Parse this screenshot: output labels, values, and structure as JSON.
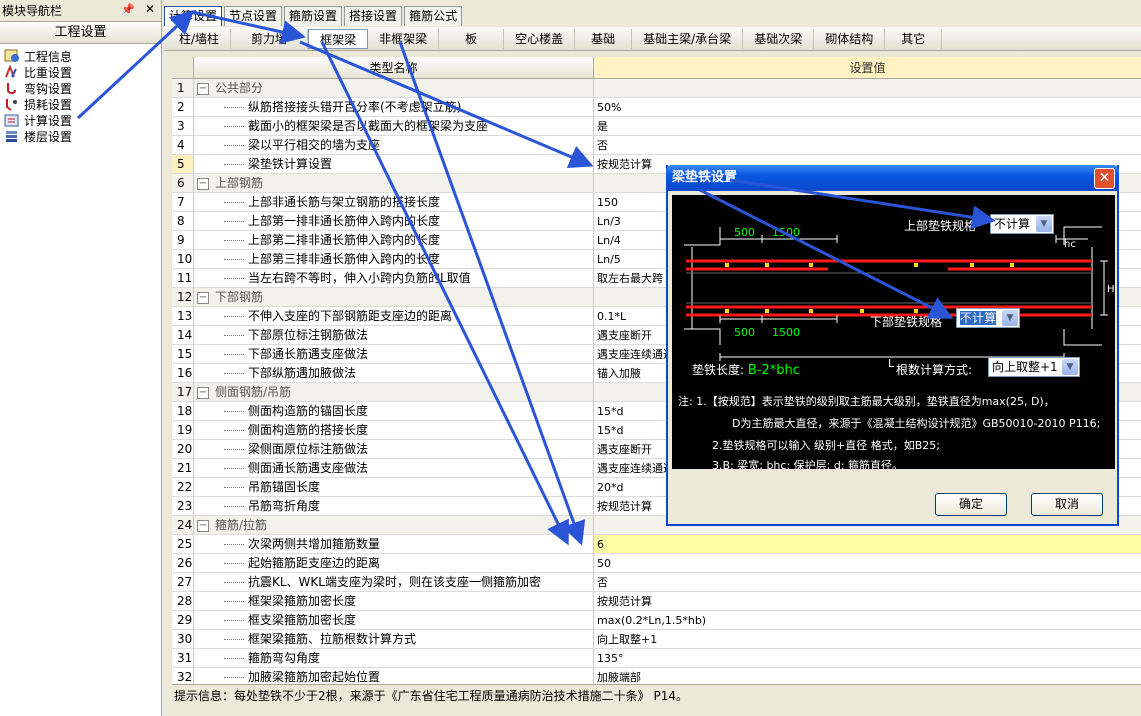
{
  "nav": {
    "title": "模块导航栏",
    "pin": "📌",
    "close": "✕",
    "section": "工程设置",
    "items": [
      {
        "label": "工程信息",
        "icon": "info-icon"
      },
      {
        "label": "比重设置",
        "icon": "weight-icon"
      },
      {
        "label": "弯钩设置",
        "icon": "hook-icon"
      },
      {
        "label": "损耗设置",
        "icon": "loss-icon"
      },
      {
        "label": "计算设置",
        "icon": "calc-icon"
      },
      {
        "label": "楼层设置",
        "icon": "floor-icon"
      }
    ]
  },
  "tabs": [
    "计算设置",
    "节点设置",
    "箍筋设置",
    "搭接设置",
    "箍筋公式"
  ],
  "subtabs": [
    "柱/墙柱",
    "剪力墙",
    "框架梁",
    "非框架梁",
    "板",
    "空心楼盖",
    "基础",
    "基础主梁/承台梁",
    "基础次梁",
    "砌体结构",
    "其它"
  ],
  "grid": {
    "col_name": "类型名称",
    "col_value": "设置值",
    "rows": [
      {
        "n": "1",
        "name": "公共部分",
        "value": "",
        "group": true
      },
      {
        "n": "2",
        "name": "纵筋搭接接头错开百分率(不考虑架立筋)",
        "value": "50%"
      },
      {
        "n": "3",
        "name": "截面小的框架梁是否以截面大的框架梁为支座",
        "value": "是"
      },
      {
        "n": "4",
        "name": "梁以平行相交的墙为支座",
        "value": "否"
      },
      {
        "n": "5",
        "name": "梁垫铁计算设置",
        "value": "按规范计算",
        "hilite": true
      },
      {
        "n": "6",
        "name": "上部钢筋",
        "value": "",
        "group": true
      },
      {
        "n": "7",
        "name": "上部非通长筋与架立钢筋的搭接长度",
        "value": "150"
      },
      {
        "n": "8",
        "name": "上部第一排非通长筋伸入跨内的长度",
        "value": "Ln/3"
      },
      {
        "n": "9",
        "name": "上部第二排非通长筋伸入跨内的长度",
        "value": "Ln/4"
      },
      {
        "n": "10",
        "name": "上部第三排非通长筋伸入跨内的长度",
        "value": "Ln/5"
      },
      {
        "n": "11",
        "name": "当左右跨不等时，伸入小跨内负筋的L取值",
        "value": "取左右最大跨"
      },
      {
        "n": "12",
        "name": "下部钢筋",
        "value": "",
        "group": true
      },
      {
        "n": "13",
        "name": "不伸入支座的下部钢筋距支座边的距离",
        "value": "0.1*L"
      },
      {
        "n": "14",
        "name": "下部原位标注钢筋做法",
        "value": "遇支座断开"
      },
      {
        "n": "15",
        "name": "下部通长筋遇支座做法",
        "value": "遇支座连续通过"
      },
      {
        "n": "16",
        "name": "下部纵筋遇加腋做法",
        "value": "锚入加腋"
      },
      {
        "n": "17",
        "name": "侧面钢筋/吊筋",
        "value": "",
        "group": true
      },
      {
        "n": "18",
        "name": "侧面构造筋的锚固长度",
        "value": "15*d"
      },
      {
        "n": "19",
        "name": "侧面构造筋的搭接长度",
        "value": "15*d"
      },
      {
        "n": "20",
        "name": "梁侧面原位标注筋做法",
        "value": "遇支座断开"
      },
      {
        "n": "21",
        "name": "侧面通长筋遇支座做法",
        "value": "遇支座连续通过"
      },
      {
        "n": "22",
        "name": "吊筋锚固长度",
        "value": "20*d"
      },
      {
        "n": "23",
        "name": "吊筋弯折角度",
        "value": "按规范计算"
      },
      {
        "n": "24",
        "name": "箍筋/拉筋",
        "value": "",
        "group": true
      },
      {
        "n": "25",
        "name": "次梁两侧共增加箍筋数量",
        "value": "6",
        "yellow": true
      },
      {
        "n": "26",
        "name": "起始箍筋距支座边的距离",
        "value": "50"
      },
      {
        "n": "27",
        "name": "抗震KL、WKL端支座为梁时，则在该支座一侧箍筋加密",
        "value": "否"
      },
      {
        "n": "28",
        "name": "框架梁箍筋加密长度",
        "value": "按规范计算"
      },
      {
        "n": "29",
        "name": "框支梁箍筋加密长度",
        "value": "max(0.2*Ln,1.5*hb)"
      },
      {
        "n": "30",
        "name": "框架梁箍筋、拉筋根数计算方式",
        "value": "向上取整+1"
      },
      {
        "n": "31",
        "name": "箍筋弯勾角度",
        "value": "135°"
      },
      {
        "n": "32",
        "name": "加腋梁箍筋加密起始位置",
        "value": "加腋端部"
      }
    ]
  },
  "status": "提示信息：每处垫铁不少于2根，来源于《广东省住宅工程质量通病防治技术措施二十条》 P14。",
  "dialog": {
    "title": "梁垫铁设置",
    "close": "✕",
    "top_label": "上部垫铁规格",
    "top_value": "不计算",
    "bottom_label": "下部垫铁规格",
    "bottom_value": "不计算",
    "length_label": "垫铁长度:",
    "length_formula": "B-2*bhc",
    "count_label": "根数计算方式:",
    "count_value": "向上取整+1",
    "dims": {
      "d500": "500",
      "d1500": "1500",
      "hc": "hc",
      "L": "L",
      "H": "H"
    },
    "notes": [
      "注: 1.【按规范】表示垫铁的级别取主筋最大级别，垫铁直径为max(25, D)，",
      "D为主筋最大直径，来源于《混凝土结构设计规范》GB50010-2010 P116;",
      "2.垫铁规格可以输入 级别+直径 格式，如B25;",
      "3.B: 梁宽; bhc: 保护层; d: 箍筋直径。"
    ],
    "ok": "确定",
    "cancel": "取消"
  },
  "colors": {
    "accent": "#2a55d6",
    "rebar": "#ff0000",
    "dim": "#00ff00"
  }
}
